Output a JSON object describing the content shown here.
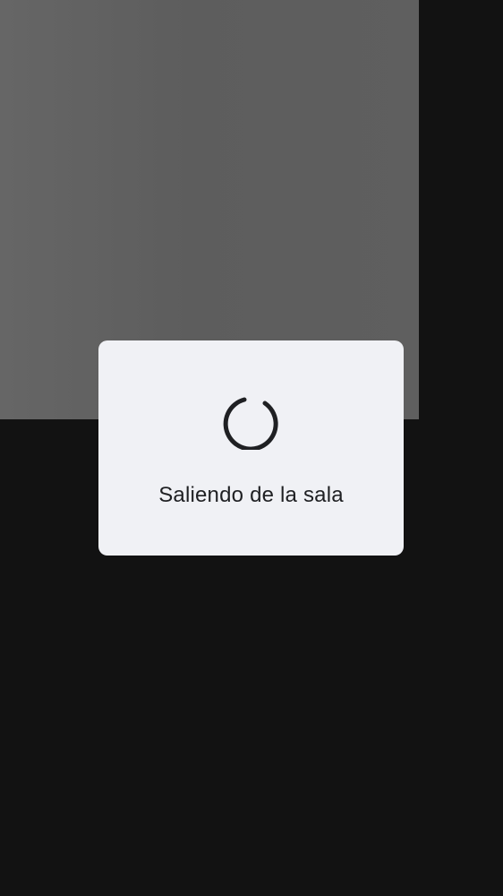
{
  "leaving_dialog": {
    "message": "Saliendo de la sala",
    "spinner_icon": "loading-spinner-icon"
  },
  "colors": {
    "background": "#121212",
    "video_tile": "#5f5f5f",
    "dialog_bg": "#f0f1f5",
    "text": "#1f2023"
  }
}
